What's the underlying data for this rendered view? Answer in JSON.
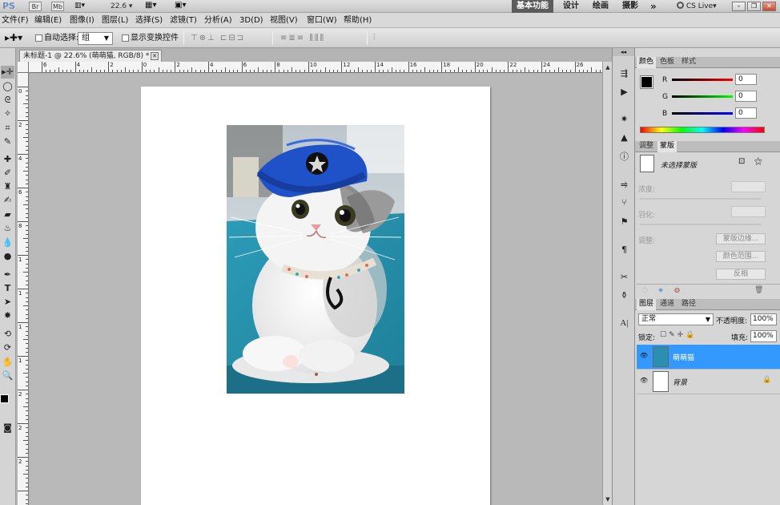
{
  "appbar": {
    "logo": "PS",
    "btn_br": "Br",
    "btn_mb": "Mb",
    "zoom": "22.6",
    "workspace_active": "基本功能",
    "workspace_items": [
      "设计",
      "绘画",
      "摄影",
      "»"
    ],
    "cs_live": "CS Live"
  },
  "menu": [
    "文件(F)",
    "编辑(E)",
    "图像(I)",
    "图层(L)",
    "选择(S)",
    "滤镜(T)",
    "分析(A)",
    "3D(D)",
    "视图(V)",
    "窗口(W)",
    "帮助(H)"
  ],
  "options": {
    "auto_select_label": "自动选择:",
    "auto_select_value": "组",
    "transform_label": "显示变换控件"
  },
  "document": {
    "tab_title": "未标题-1 @ 22.6% (萌萌猫, RGB/8) *",
    "hruler_ticks": [
      "6",
      "4",
      "2",
      "0",
      "2",
      "4",
      "6",
      "8",
      "10",
      "12",
      "14",
      "16",
      "18",
      "20",
      "22",
      "24",
      "26"
    ],
    "vruler_ticks": [
      "0",
      "2",
      "4",
      "6",
      "8",
      "1",
      "1",
      "1",
      "1",
      "2",
      "2",
      "2"
    ]
  },
  "color_panel": {
    "tabs": [
      "颜色",
      "色板",
      "样式"
    ],
    "channels": [
      {
        "label": "R",
        "value": "0",
        "color": "#cc0000"
      },
      {
        "label": "G",
        "value": "0",
        "color": "#00aa00"
      },
      {
        "label": "B",
        "value": "0",
        "color": "#0000cc"
      }
    ]
  },
  "masks_panel": {
    "tabs": [
      "调整",
      "蒙版"
    ],
    "no_mask": "未选择蒙版",
    "density": "浓度:",
    "feather": "羽化:",
    "refine": "调整:",
    "btn_edge": "蒙版边缘...",
    "btn_range": "颜色范围...",
    "btn_invert": "反相"
  },
  "layers_panel": {
    "tabs": [
      "图层",
      "通道",
      "路径"
    ],
    "blend_mode": "正常",
    "opacity_label": "不透明度:",
    "opacity_value": "100%",
    "lock_label": "锁定:",
    "fill_label": "填充:",
    "fill_value": "100%",
    "layers": [
      {
        "name": "萌萌猫",
        "selected": true
      },
      {
        "name": "背景",
        "selected": false
      }
    ]
  },
  "colors": {
    "selection": "#3399ff",
    "canvas_bg": "#b4b4b4",
    "hat": "#1f52c8"
  }
}
